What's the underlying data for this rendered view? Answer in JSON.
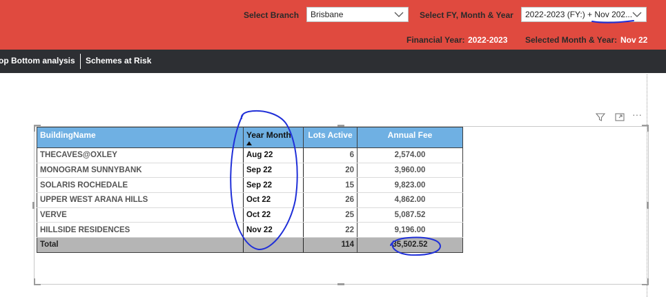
{
  "header": {
    "branch_label": "Select Branch",
    "branch_value": "Brisbane",
    "fy_label": "Select FY, Month & Year",
    "fy_value": "2022-2023 (FY:) + Nov 202...",
    "financial_year_label": "Financial Year:",
    "financial_year_value": "2022-2023",
    "selected_month_label": "Selected Month & Year:",
    "selected_month_value": "Nov 22"
  },
  "nav": {
    "items": [
      {
        "label": "op Bottom analysis"
      },
      {
        "label": "Schemes at Risk"
      }
    ]
  },
  "visual_toolbar": {
    "icons": [
      "filter-icon",
      "focus-mode-icon",
      "more-options-icon"
    ],
    "more_glyph": "···"
  },
  "table": {
    "columns": [
      "BuildingName",
      "Year Month",
      "Lots Active",
      "Annual Fee"
    ],
    "sorted_column": "Year Month",
    "rows": [
      {
        "name": "THECAVES@OXLEY",
        "year_month": "Aug 22",
        "lots": "6",
        "fee": "2,574.00"
      },
      {
        "name": "MONOGRAM SUNNYBANK",
        "year_month": "Sep 22",
        "lots": "20",
        "fee": "3,960.00"
      },
      {
        "name": "SOLARIS ROCHEDALE",
        "year_month": "Sep 22",
        "lots": "15",
        "fee": "9,823.00"
      },
      {
        "name": "UPPER WEST ARANA HILLS",
        "year_month": "Oct 22",
        "lots": "26",
        "fee": "4,862.00"
      },
      {
        "name": "VERVE",
        "year_month": "Oct 22",
        "lots": "25",
        "fee": "5,087.52"
      },
      {
        "name": "HILLSIDE RESIDENCES",
        "year_month": "Nov 22",
        "lots": "22",
        "fee": "9,196.00"
      }
    ],
    "total": {
      "label": "Total",
      "year_month": "",
      "lots": "114",
      "fee": "35,502.52"
    }
  },
  "colors": {
    "header_red": "#e04a3f",
    "nav_dark": "#2d2f33",
    "table_header_blue": "#6fb0e3",
    "total_row_grey": "#b5b5b5",
    "annotation_ink": "#1f2fd8"
  }
}
